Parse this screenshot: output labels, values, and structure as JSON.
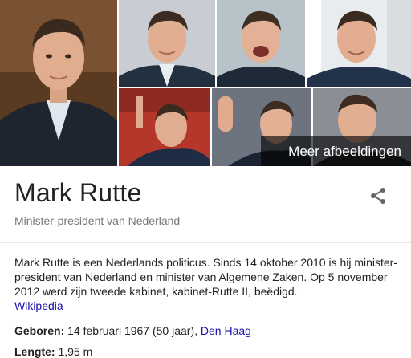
{
  "gallery": {
    "more_images_label": "Meer afbeeldingen"
  },
  "header": {
    "title": "Mark Rutte",
    "subtitle": "Minister-president van Nederland"
  },
  "description": {
    "text": "Mark Rutte is een Nederlands politicus. Sinds 14 oktober 2010 is hij minister-president van Nederland en minister van Algemene Zaken. Op 5 november 2012 werd zijn tweede kabinet, kabinet-Rutte II, beëdigd.",
    "source_link": "Wikipedia"
  },
  "facts": [
    {
      "label": "Geboren:",
      "value": "14 februari 1967 (50 jaar),",
      "link": "Den Haag"
    },
    {
      "label": "Lengte:",
      "value": "1,95 m"
    }
  ],
  "icons": {
    "share": "share-icon"
  }
}
